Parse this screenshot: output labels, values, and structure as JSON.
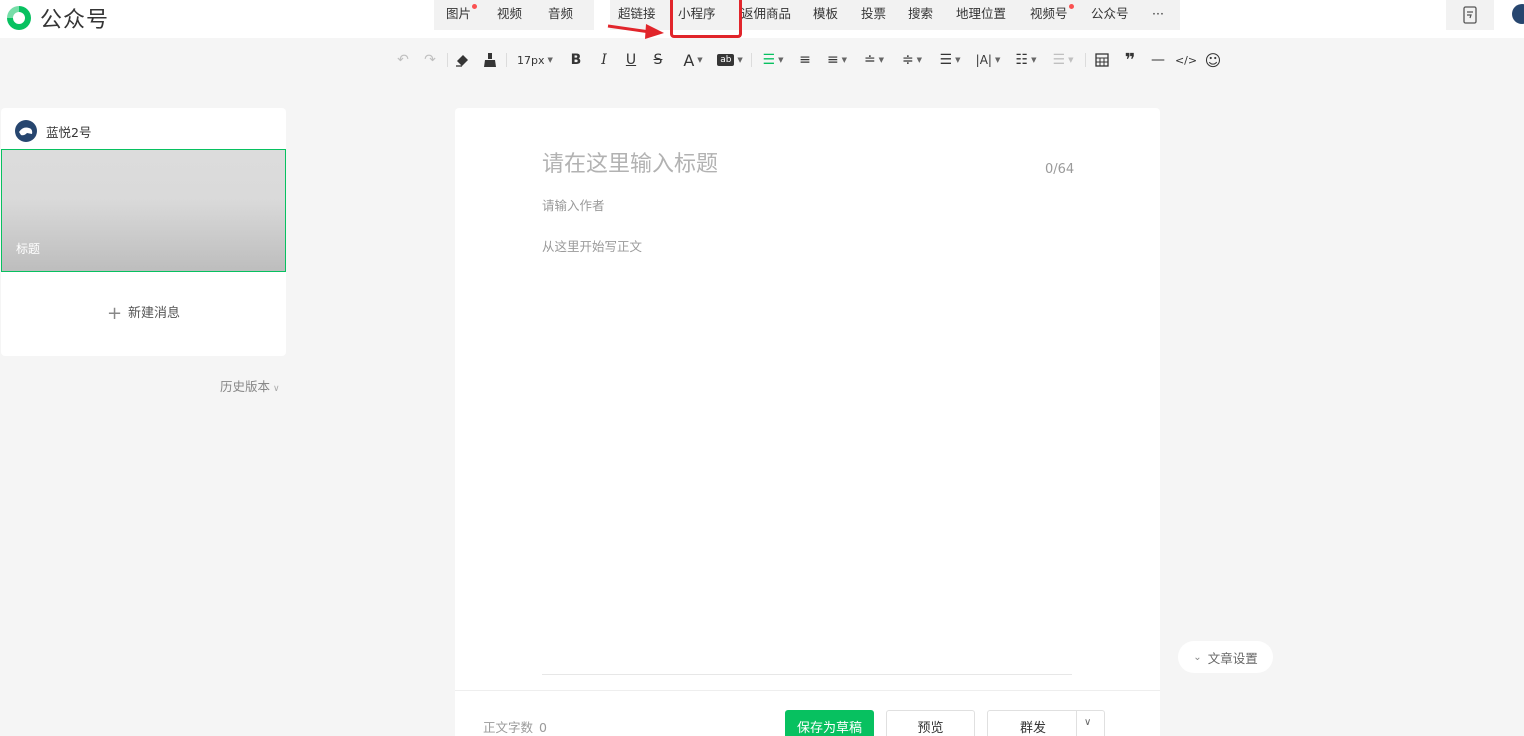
{
  "logo": {
    "text": "公众号",
    "color": "#07c160"
  },
  "insert_menu": {
    "items": [
      {
        "label": "图片",
        "dot": true
      },
      {
        "label": "视频",
        "dot": false
      },
      {
        "label": "音频",
        "dot": false
      },
      {
        "label": "超链接",
        "dot": false
      },
      {
        "label": "小程序",
        "dot": false,
        "highlighted": true
      },
      {
        "label": "返佣商品",
        "dot": false
      },
      {
        "label": "模板",
        "dot": false
      },
      {
        "label": "投票",
        "dot": false
      },
      {
        "label": "搜索",
        "dot": false
      },
      {
        "label": "地理位置",
        "dot": false
      },
      {
        "label": "视频号",
        "dot": true
      },
      {
        "label": "公众号",
        "dot": false
      },
      {
        "label": "···",
        "dot": false
      }
    ]
  },
  "toolbar": {
    "font_size": "17px",
    "bold": "B",
    "italic": "I",
    "underline": "U",
    "strike": "S",
    "font_color": "A",
    "bg_color": "ab"
  },
  "left_panel": {
    "account_name": "蓝悦2号",
    "cover_title": "标题",
    "new_message": "新建消息",
    "history": "历史版本"
  },
  "editor": {
    "title_placeholder": "请在这里输入标题",
    "title_count": "0/64",
    "author_placeholder": "请输入作者",
    "body_placeholder": "从这里开始写正文"
  },
  "bottom": {
    "word_count_label": "正文字数",
    "word_count_value": "0",
    "save_draft": "保存为草稿",
    "preview": "预览",
    "publish": "群发"
  },
  "article_settings": "文章设置",
  "colors": {
    "accent": "#07c160",
    "highlight": "#e1252b"
  }
}
